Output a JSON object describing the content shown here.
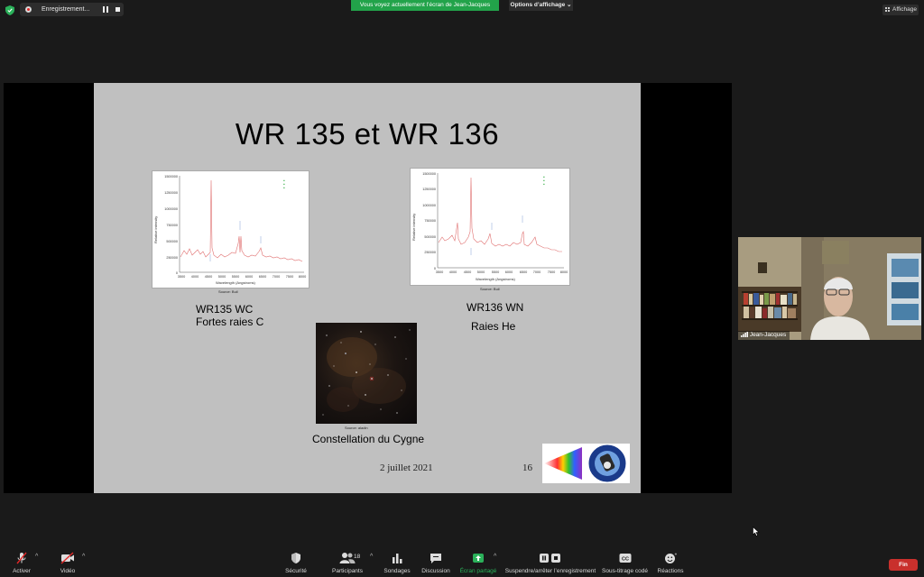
{
  "topbar": {
    "recording_label": "Enregistrement...",
    "share_banner": "Vous voyez actuellement l’écran de Jean-Jacques",
    "options_label": "Options d’affichage ⌄",
    "view_label": "Affichage"
  },
  "slide": {
    "title": "WR 135 et WR 136",
    "left_spectrum": {
      "name": "WR135 WC",
      "desc": "Fortes raies C",
      "source": "Source: Buil",
      "ylabel": "Relative intensity",
      "xlabel": "Wavelength (Angstroms)",
      "y_ticks": [
        "1500000",
        "1250000",
        "1000000",
        "750000",
        "500000",
        "250000",
        "0"
      ],
      "x_ticks": [
        "3500",
        "4000",
        "4500",
        "5000",
        "5500",
        "6000",
        "6500",
        "7000",
        "7500",
        "8000"
      ]
    },
    "right_spectrum": {
      "name": "WR136 WN",
      "desc": "Raies He",
      "source": "Source: Buil",
      "ylabel": "Relative intensity",
      "xlabel": "Wavelength (Angstroms)",
      "y_ticks": [
        "1500000",
        "1250000",
        "1000000",
        "750000",
        "500000",
        "250000",
        "0"
      ],
      "x_ticks": [
        "3500",
        "4000",
        "4500",
        "5000",
        "5500",
        "6000",
        "6500",
        "7000",
        "7500",
        "8000"
      ]
    },
    "sky_source": "Source: aladin",
    "sky_caption": "Constellation du Cygne",
    "date": "2 juillet 2021",
    "page": "16"
  },
  "participant": {
    "name": "Jean-Jacques"
  },
  "toolbar": {
    "activer": "Activer",
    "video": "Vidéo",
    "securite": "Sécurité",
    "participants": "Participants",
    "participants_count": "18",
    "sondages": "Sondages",
    "discussion": "Discussion",
    "ecran_partage": "Écran partagé",
    "suspendre": "Suspendre/arrêter l’enregistrement",
    "sous_titrage": "Sous-titrage codé",
    "reactions": "Réactions",
    "fin": "Fin"
  },
  "colors": {
    "share_green": "#22a34a",
    "end_red": "#c9302c",
    "spectrum_line": "#e07070"
  }
}
